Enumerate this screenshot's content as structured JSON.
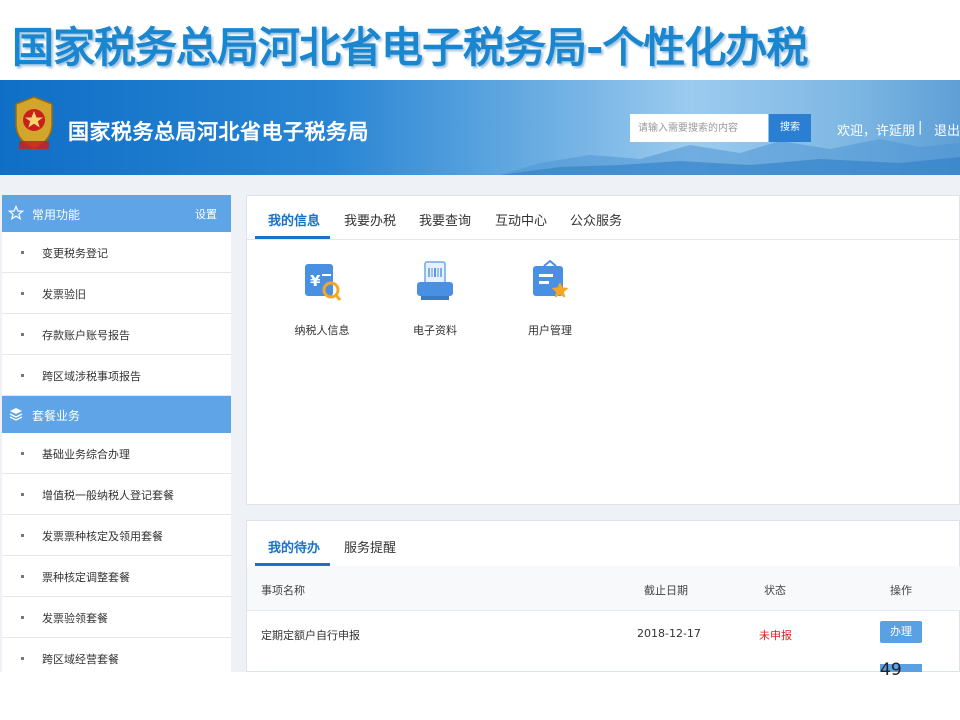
{
  "slide": {
    "title": "国家税务总局河北省电子税务局-个性化办税",
    "page_number": "49"
  },
  "header": {
    "site_name": "国家税务总局河北省电子税务局",
    "search_placeholder": "请输入需要搜索的内容",
    "search_button": "搜索",
    "welcome": "欢迎，许延朋",
    "separator": "|",
    "logout": "退出"
  },
  "sidebar": {
    "common": {
      "title": "常用功能",
      "settings": "设置",
      "items": [
        "变更税务登记",
        "发票验旧",
        "存款账户账号报告",
        "跨区域涉税事项报告"
      ]
    },
    "package": {
      "title": "套餐业务",
      "items": [
        "基础业务综合办理",
        "增值税一般纳税人登记套餐",
        "发票票种核定及领用套餐",
        "票种核定调整套餐",
        "发票验领套餐",
        "跨区域经营套餐"
      ]
    }
  },
  "top_panel": {
    "tabs": [
      "我的信息",
      "我要办税",
      "我要查询",
      "互动中心",
      "公众服务"
    ],
    "active_tab": 0,
    "tiles": [
      {
        "label": "纳税人信息",
        "icon": "taxpayer-info-icon"
      },
      {
        "label": "电子资料",
        "icon": "electronic-documents-icon"
      },
      {
        "label": "用户管理",
        "icon": "user-management-icon"
      }
    ]
  },
  "todo_panel": {
    "tabs": [
      "我的待办",
      "服务提醒"
    ],
    "columns": [
      "事项名称",
      "截止日期",
      "状态",
      "操作"
    ],
    "rows": [
      {
        "name": "定期定额户自行申报",
        "deadline": "2018-12-17",
        "status": "未申报",
        "action": "办理"
      }
    ]
  },
  "colors": {
    "accent": "#1a73c8",
    "sidebar_header": "#5ea4e6",
    "status_red": "#e02020"
  }
}
